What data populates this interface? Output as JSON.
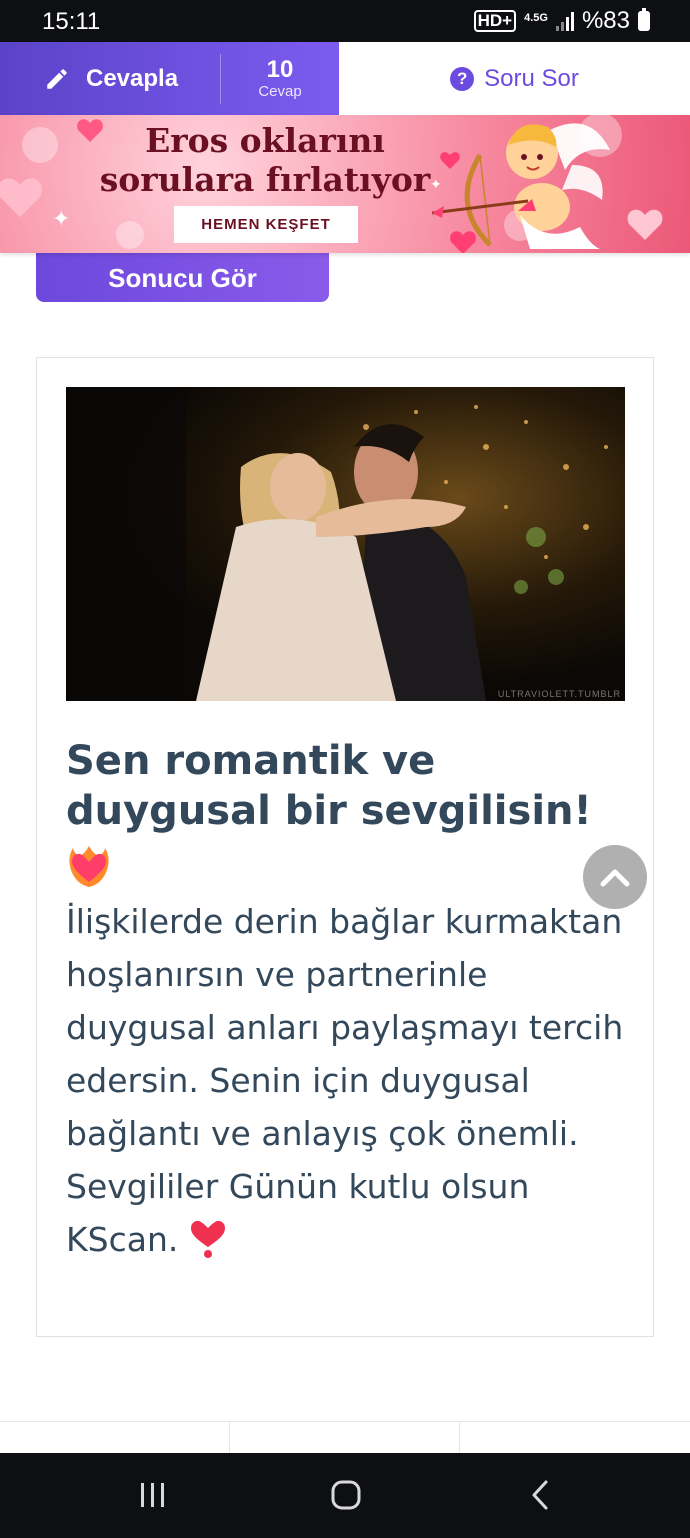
{
  "status_bar": {
    "time": "15:11",
    "hd_label": "HD+",
    "network_label": "4.5G",
    "battery_text": "%83"
  },
  "action_bar": {
    "answer_label": "Cevapla",
    "answer_count": "10",
    "answer_count_label": "Cevap",
    "ask_label": "Soru Sor",
    "accent_color": "#6c4ce0"
  },
  "banner": {
    "title_line1": "Eros oklarını",
    "title_line2": "sorulara fırlatıyor",
    "cta_label": "HEMEN KEŞFET"
  },
  "quiz": {
    "result_button_label": "Sonucu Gör"
  },
  "result": {
    "image_watermark": "ULTRAVIOLETT.TUMBLR",
    "title": "Sen romantik ve duygusal bir sevgilisin!",
    "body": "İlişkilerde derin bağlar kurmaktan hoşlanırsın ve partnerinle duygusal anları paylaşmayı tercih edersin. Senin için duygusal bağlantı ve anlayış çok önemli. Sevgililer Günün kutlu olsun KScan.",
    "title_emoji": "heart-on-fire",
    "body_emoji": "heart-exclamation"
  },
  "nav_bar": {
    "icons": [
      "recent-apps-icon",
      "home-icon",
      "back-icon"
    ]
  }
}
